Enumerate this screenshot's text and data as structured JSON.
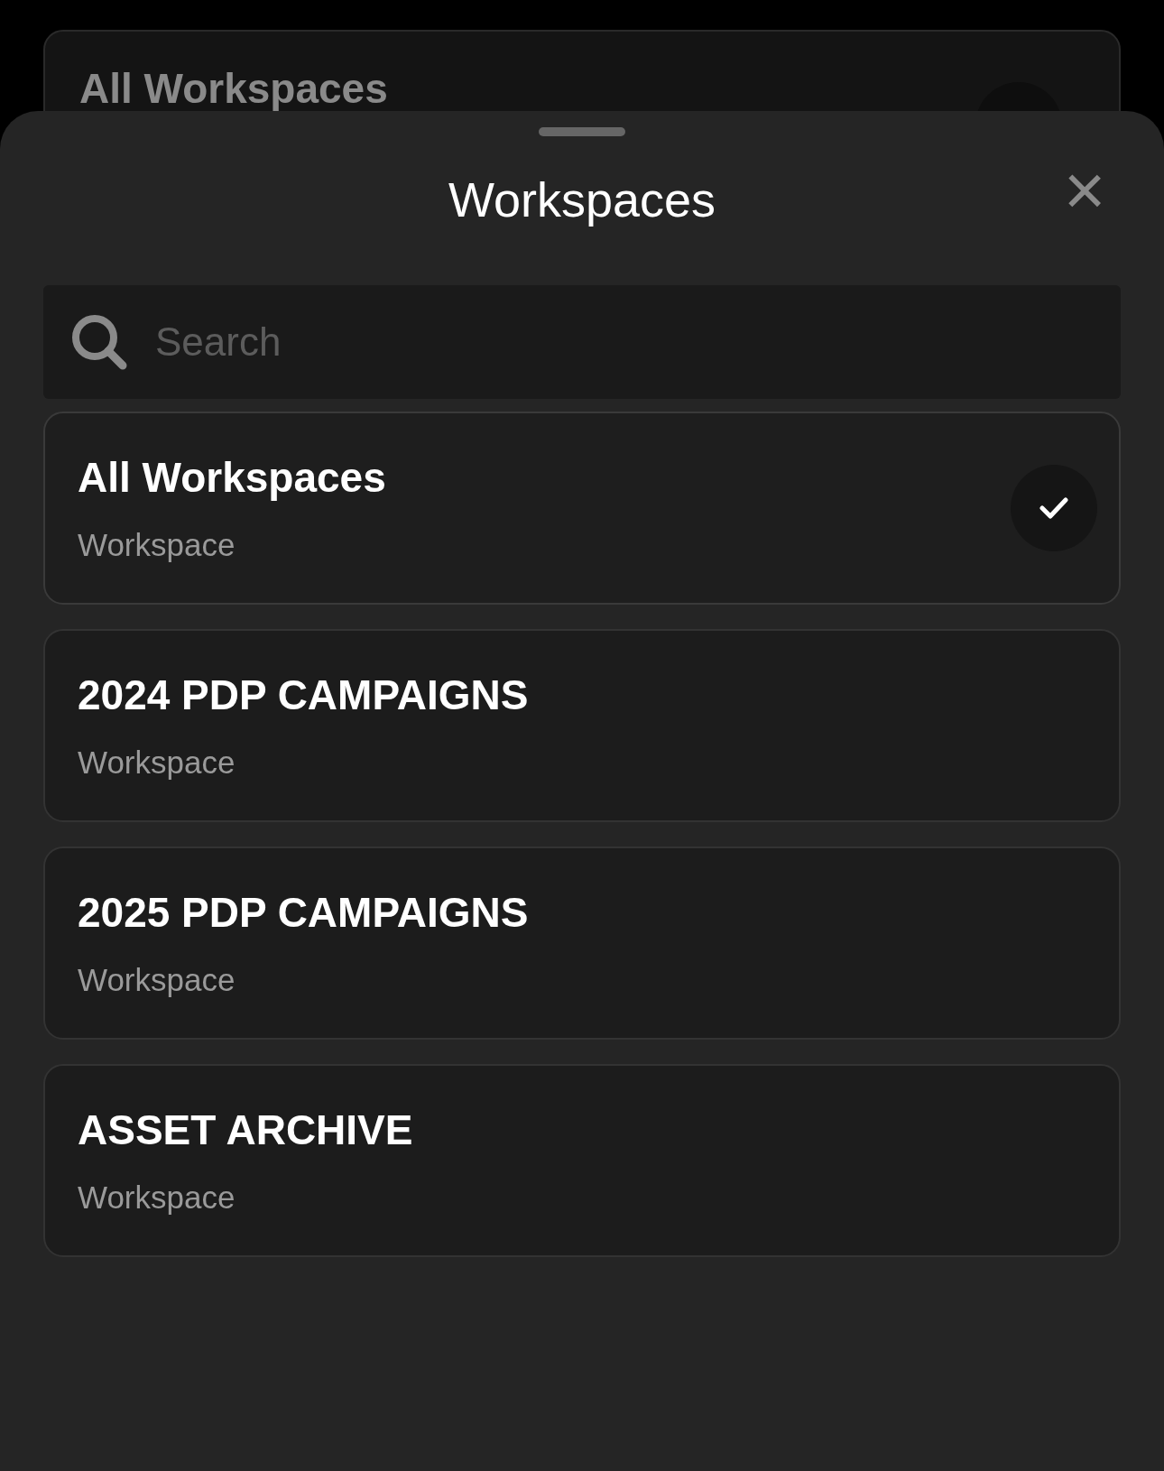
{
  "background_card": {
    "title": "All Workspaces",
    "selected": true
  },
  "sheet": {
    "title": "Workspaces",
    "close_icon": "×",
    "search": {
      "placeholder": "Search"
    },
    "items": [
      {
        "title": "All Workspaces",
        "subtitle": "Workspace",
        "selected": true
      },
      {
        "title": "2024 PDP CAMPAIGNS",
        "subtitle": "Workspace",
        "selected": false
      },
      {
        "title": "2025 PDP CAMPAIGNS",
        "subtitle": "Workspace",
        "selected": false
      },
      {
        "title": "ASSET ARCHIVE",
        "subtitle": "Workspace",
        "selected": false
      }
    ]
  }
}
